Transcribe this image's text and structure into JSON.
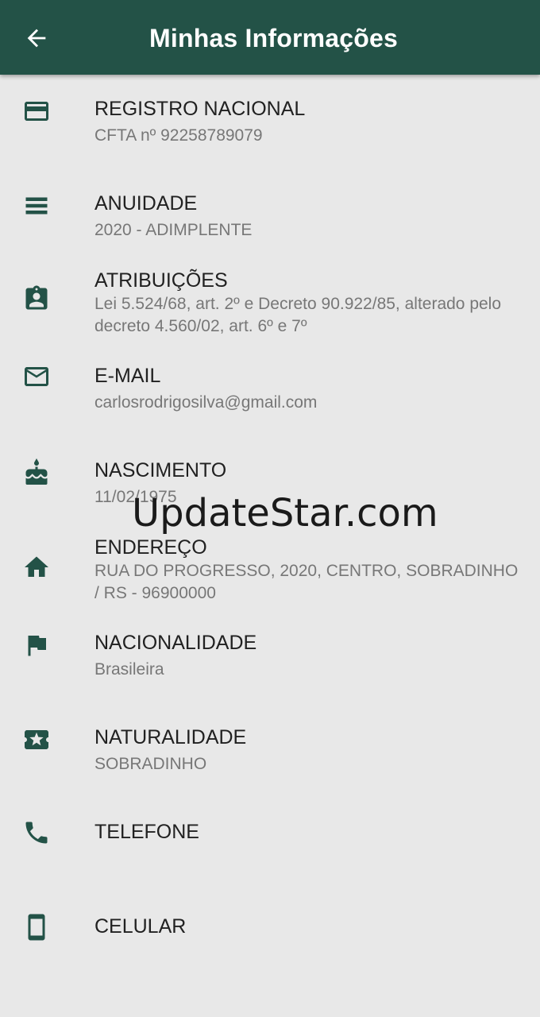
{
  "appbar": {
    "title": "Minhas Informações",
    "color": "#235247",
    "back_icon": "arrow-back-icon"
  },
  "items": [
    {
      "icon": "credit-card-icon",
      "label": "REGISTRO NACIONAL",
      "value": "CFTA nº 92258789079"
    },
    {
      "icon": "list-bars-icon",
      "label": "ANUIDADE",
      "value": "2020 - ADIMPLENTE"
    },
    {
      "icon": "assignment-ind-icon",
      "label": "ATRIBUIÇÕES",
      "value": "Lei 5.524/68, art. 2º e Decreto 90.922/85, alterado pelo decreto 4.560/02, art. 6º e 7º"
    },
    {
      "icon": "mail-icon",
      "label": "E-MAIL",
      "value": "carlosrodrigosilva@gmail.com"
    },
    {
      "icon": "cake-icon",
      "label": "NASCIMENTO",
      "value": "11/02/1975"
    },
    {
      "icon": "home-icon",
      "label": "ENDEREÇO",
      "value": "RUA DO PROGRESSO, 2020, CENTRO, SOBRADINHO / RS - 96900000"
    },
    {
      "icon": "flag-icon",
      "label": "NACIONALIDADE",
      "value": "Brasileira"
    },
    {
      "icon": "local-activity-icon",
      "label": "NATURALIDADE",
      "value": "SOBRADINHO"
    },
    {
      "icon": "phone-icon",
      "label": "TELEFONE",
      "value": ""
    },
    {
      "icon": "smartphone-icon",
      "label": "CELULAR",
      "value": ""
    }
  ],
  "watermark": "UpdateStar.com"
}
